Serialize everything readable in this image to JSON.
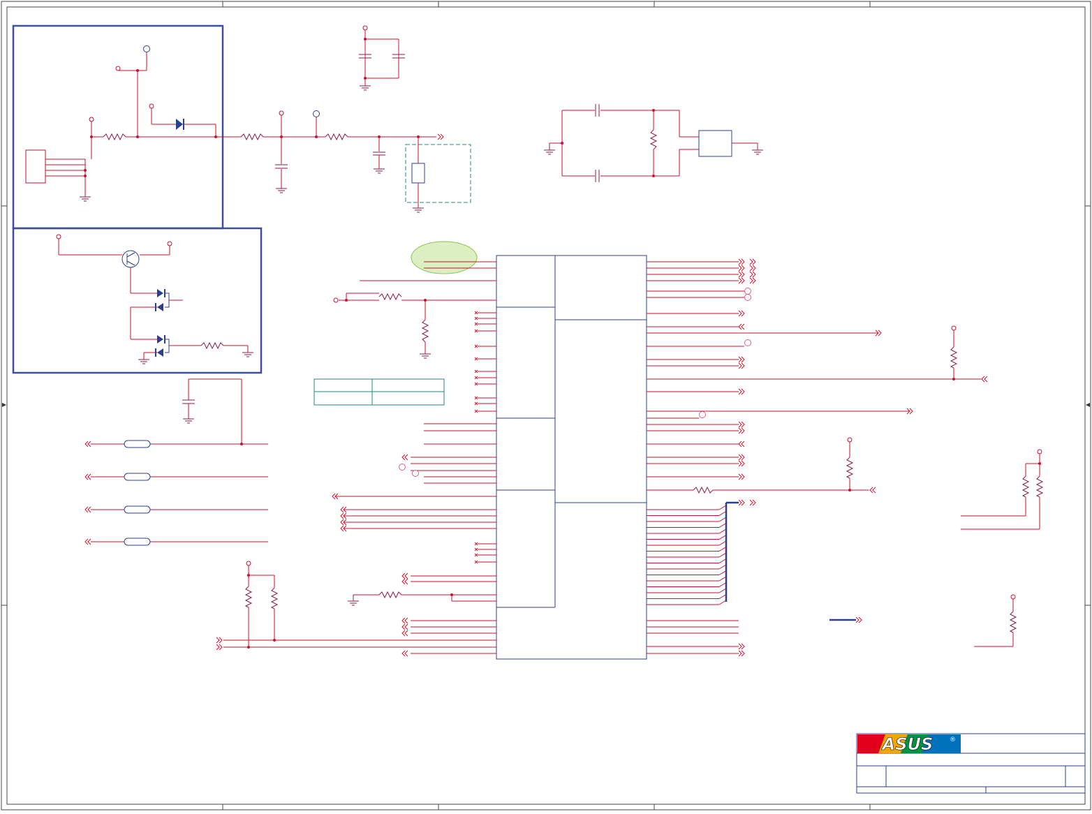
{
  "title_block": {
    "logo_text": "ASUS",
    "registered_mark": "®",
    "logo_colors": [
      "#e2001a",
      "#f7a600",
      "#00923f",
      "#0072bc",
      "#2e3192"
    ]
  },
  "colors": {
    "wire": "#c8102e",
    "component": "#8b1a4a",
    "border": "#2b3f8f",
    "box_outline": "#3a4fa0",
    "teal_box": "#1f8a7a",
    "highlight": "#8bc34a",
    "blue_bus": "#2b3f8f"
  },
  "icons": [
    "resistor-icon",
    "capacitor-icon",
    "ground-icon",
    "diode-icon",
    "transistor-icon",
    "offpage-connector-icon",
    "power-rail-icon"
  ]
}
